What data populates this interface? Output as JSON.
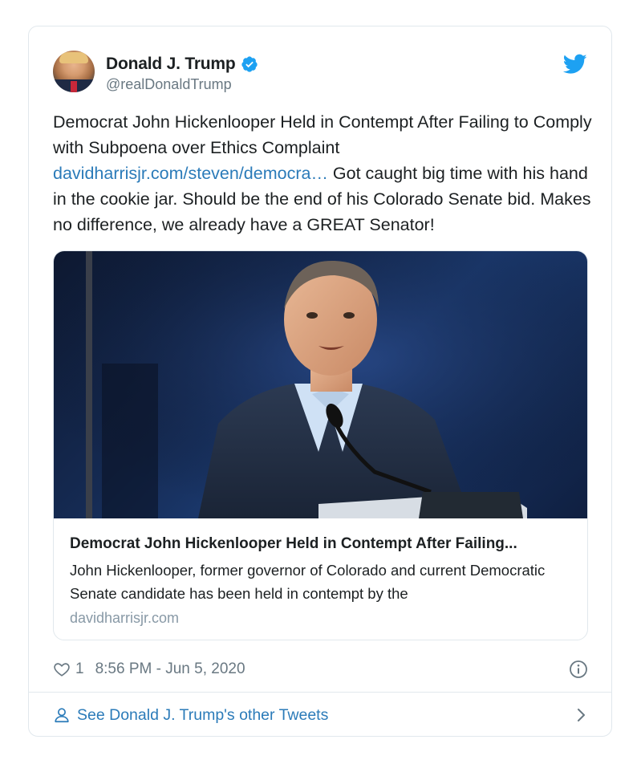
{
  "author": {
    "display_name": "Donald J. Trump",
    "handle": "@realDonaldTrump",
    "verified": true
  },
  "icons": {
    "verified": "verified-badge-icon",
    "bird": "twitter-bird-icon",
    "heart": "heart-icon",
    "info": "info-icon",
    "person": "person-icon",
    "chevron": "chevron-right-icon"
  },
  "tweet": {
    "text_part1": "Democrat John Hickenlooper Held in Contempt After Failing to Comply with Subpoena over Ethics Complaint ",
    "link_text": "davidharrisjr.com/steven/democra…",
    "text_part2": " Got caught big time with his hand in the cookie jar. Should be the end of his Colorado Senate bid. Makes no difference, we already have a GREAT Senator!"
  },
  "card": {
    "title": "Democrat John Hickenlooper Held in Contempt After Failing...",
    "description": "John Hickenlooper, former governor of Colorado and current Democratic Senate candidate has been held in contempt by the",
    "domain": "davidharrisjr.com"
  },
  "meta": {
    "like_count": "1",
    "timestamp": "8:56 PM - Jun 5, 2020"
  },
  "footer": {
    "label": "See Donald J. Trump's other Tweets"
  },
  "colors": {
    "link": "#2b7bb9",
    "verified": "#1da1f2",
    "text": "#1c2022",
    "muted": "#697882",
    "border": "#e1e8ed"
  }
}
